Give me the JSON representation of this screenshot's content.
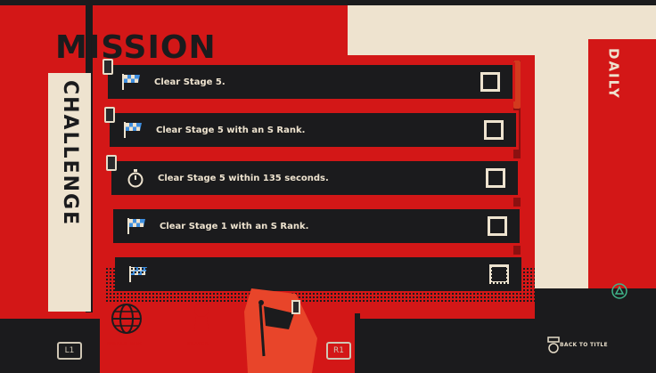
{
  "screen": {
    "title": "MISSION",
    "challenge_tab": "CHALLENGE",
    "daily_tab": "DAILY"
  },
  "missions": [
    {
      "label": "Clear Stage 5.",
      "icon": "checkered-flag-icon",
      "checked": false
    },
    {
      "label": "Clear Stage 5 with an S Rank.",
      "icon": "checkered-flag-icon",
      "checked": false
    },
    {
      "label": "Clear Stage 5 within 135 seconds.",
      "icon": "stopwatch-icon",
      "checked": false
    },
    {
      "label": "Clear Stage 1 with an S Rank.",
      "icon": "checkered-flag-icon",
      "checked": false
    },
    {
      "label": "",
      "icon": "checkered-flag-icon",
      "checked": false
    }
  ],
  "footer": {
    "l1_button": "L1",
    "r1_button": "R1",
    "nav_world_label": "WORLD MAP",
    "nav_player_label": "PLAYER",
    "back_label": "BACK TO TITLE"
  },
  "colors": {
    "accent_red": "#d31717",
    "cream": "#eee3cf",
    "dark": "#1b1b1d",
    "flag_blue": "#3f8fe0"
  }
}
